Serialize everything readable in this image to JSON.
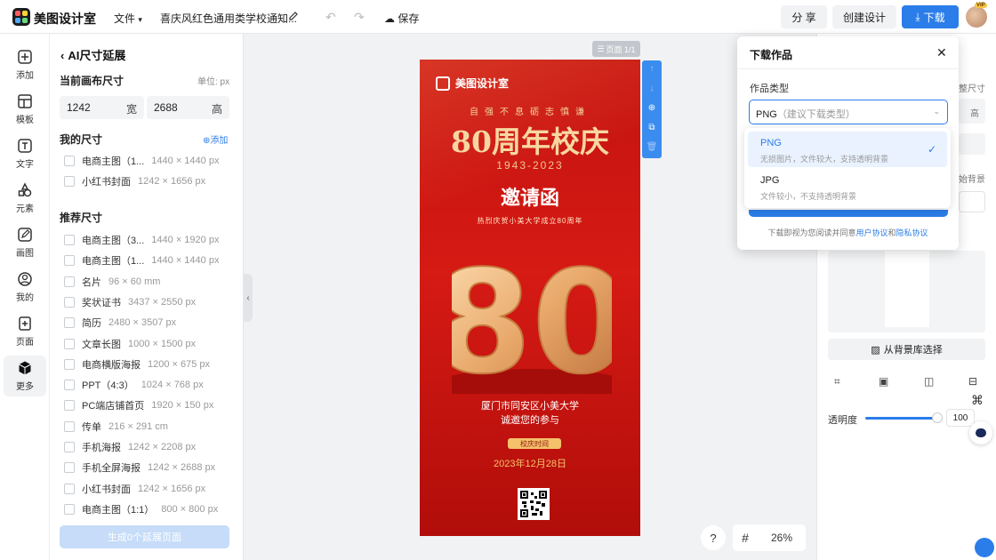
{
  "header": {
    "brand": "美图设计室",
    "file_menu": "文件",
    "doc_title": "喜庆风红色通用类学校通知...",
    "save": "保存",
    "share": "分 享",
    "create": "创建设计",
    "download": "下载",
    "vip_badge": "VIP"
  },
  "rail": [
    {
      "label": "添加",
      "icon": "plus-square-icon"
    },
    {
      "label": "模板",
      "icon": "template-icon"
    },
    {
      "label": "文字",
      "icon": "text-icon"
    },
    {
      "label": "元素",
      "icon": "shapes-icon"
    },
    {
      "label": "画图",
      "icon": "pencil-icon"
    },
    {
      "label": "我的",
      "icon": "user-icon"
    },
    {
      "label": "页面",
      "icon": "page-add-icon"
    },
    {
      "label": "更多",
      "icon": "cube-icon",
      "active": true
    }
  ],
  "panel": {
    "title": "AI尺寸延展",
    "current_size_label": "当前画布尺寸",
    "unit": "单位: px",
    "width_value": "1242",
    "width_label": "宽",
    "height_value": "2688",
    "height_label": "高",
    "my_sizes_label": "我的尺寸",
    "add": "添加",
    "my_sizes": [
      {
        "name": "电商主图（1...",
        "dim": "1440 × 1440 px"
      },
      {
        "name": "小红书封面",
        "dim": "1242 × 1656 px"
      }
    ],
    "recommended_label": "推荐尺寸",
    "recommended": [
      {
        "name": "电商主图（3...",
        "dim": "1440 × 1920 px"
      },
      {
        "name": "电商主图（1...",
        "dim": "1440 × 1440 px"
      },
      {
        "name": "名片",
        "dim": "96 × 60 mm"
      },
      {
        "name": "奖状证书",
        "dim": "3437 × 2550 px"
      },
      {
        "name": "简历",
        "dim": "2480 × 3507 px"
      },
      {
        "name": "文章长图",
        "dim": "1000 × 1500 px"
      },
      {
        "name": "电商横版海报",
        "dim": "1200 × 675 px"
      },
      {
        "name": "PPT（4:3）",
        "dim": "1024 × 768 px"
      },
      {
        "name": "PC端店铺首页",
        "dim": "1920 × 150 px"
      },
      {
        "name": "传单",
        "dim": "216 × 291 cm"
      },
      {
        "name": "手机海报",
        "dim": "1242 × 2208 px"
      },
      {
        "name": "手机全屏海报",
        "dim": "1242 × 2688 px"
      },
      {
        "name": "小红书封面",
        "dim": "1242 × 1656 px"
      },
      {
        "name": "电商主图（1:1）",
        "dim": "800 × 800 px"
      }
    ],
    "generate": "生成0个延展页面"
  },
  "canvas": {
    "page_indicator": "页面 1/1",
    "zoom": "26%",
    "help": "?"
  },
  "poster": {
    "brand": "美图设计室",
    "motto": "自强不息砺志慎谦",
    "title": "80周年校庆",
    "years": "1943-2023",
    "invite": "邀请函",
    "subtitle": "热烈庆贺小美大学成立80周年",
    "big_number": "80",
    "address": "厦门市同安区小美大学",
    "welcome": "诚邀您的参与",
    "tag": "校庆时间",
    "date": "2023年12月28日"
  },
  "dialog": {
    "title": "下载作品",
    "type_label": "作品类型",
    "select_value": "PNG",
    "select_hint": "（建议下载类型）",
    "options": [
      {
        "name": "PNG",
        "desc": "无损图片，文件较大，支持透明背景",
        "selected": true
      },
      {
        "name": "JPG",
        "desc": "文件较小，不支持透明背景",
        "selected": false
      }
    ],
    "footer_prefix": "下载即视为您阅读并同意",
    "footer_link1": "用户协议",
    "footer_and": "和",
    "footer_link2": "隐私协议"
  },
  "right_panel": {
    "frag1": "整尺寸",
    "frag2": "高",
    "frag3": "始背景",
    "bg_library": "从背景库选择",
    "opacity_label": "透明度",
    "opacity_value": "100"
  },
  "colors": {
    "accent": "#2b7de9",
    "poster_red": "#d61a14",
    "poster_gold": "#f5c16b"
  }
}
